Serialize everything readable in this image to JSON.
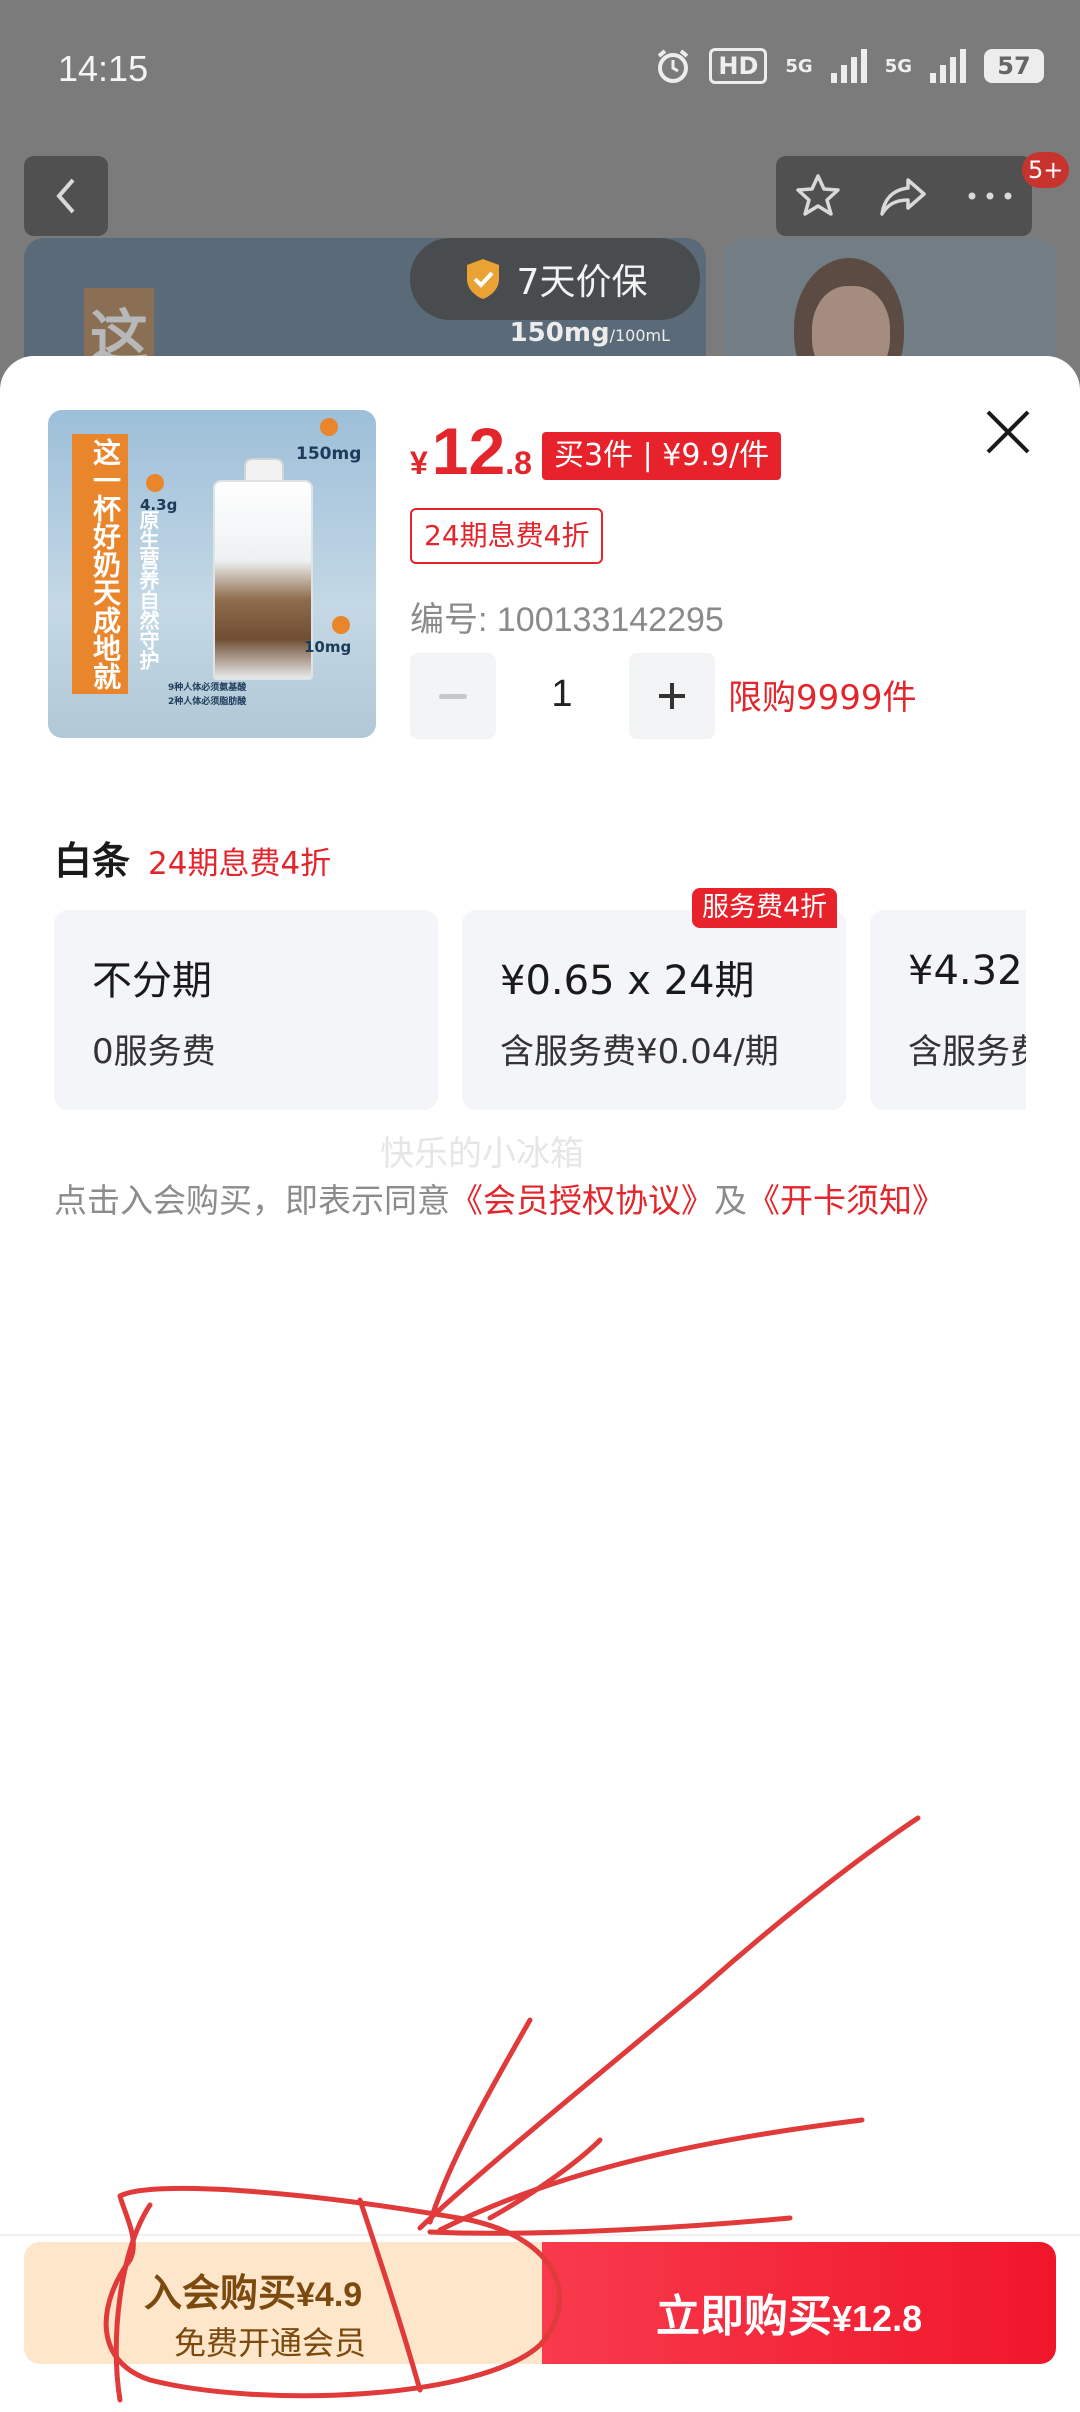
{
  "status_bar": {
    "time": "14:15",
    "hd_label": "HD",
    "network_1": "5G",
    "network_2": "5G",
    "battery": "57",
    "icons": [
      "alarm-icon",
      "hd-icon",
      "signal-icon",
      "signal-icon",
      "battery-icon"
    ]
  },
  "background_page": {
    "notification_badge": "5+",
    "price_guard": "7天价保",
    "banner_char": "这",
    "banner_spec_value": "150mg",
    "banner_spec_unit": "/100mL",
    "icons": [
      "back-icon",
      "star-icon",
      "share-icon",
      "more-icon",
      "shield-check-icon"
    ]
  },
  "product": {
    "image_title": "这一杯好奶天成地就",
    "image_subtitle": "原生营养自然守护",
    "image_labels": [
      "150mg",
      "4.3g",
      "10mg",
      "9种人体必须氨基酸",
      "2种人体必须脂肪酸"
    ],
    "price": {
      "currency": "¥",
      "integer": "12",
      "decimal": ".8",
      "color": "#e3262c"
    },
    "promo_tag": "买3件 | ¥9.9/件",
    "installment_tag": "24期息费4折",
    "sku_number": "编号: 100133142295",
    "quantity": "1",
    "purchase_limit": "限购9999件"
  },
  "baitiao": {
    "title": "白条",
    "promo": "24期息费4折",
    "plans": [
      {
        "main": "不分期",
        "sub": "0服务费",
        "badge": ""
      },
      {
        "main": "¥0.65 x 24期",
        "sub": "含服务费¥0.04/期",
        "badge": "服务费4折"
      },
      {
        "main": "¥4.32",
        "sub": "含服务费",
        "badge": ""
      }
    ]
  },
  "watermark": "快乐的小冰箱",
  "agreement": {
    "prefix": "点击入会购买，即表示同意",
    "link1": "《会员授权协议》",
    "mid": "及",
    "link2": "《开卡须知》"
  },
  "bottom": {
    "member_label": "入会购买",
    "member_price": "¥4.9",
    "member_sub": "免费开通会员",
    "buy_label": "立即购买",
    "buy_price": "¥12.8",
    "accent": "#f0162a",
    "member_bg": "#fde6ca"
  },
  "close_icon": "close-icon"
}
